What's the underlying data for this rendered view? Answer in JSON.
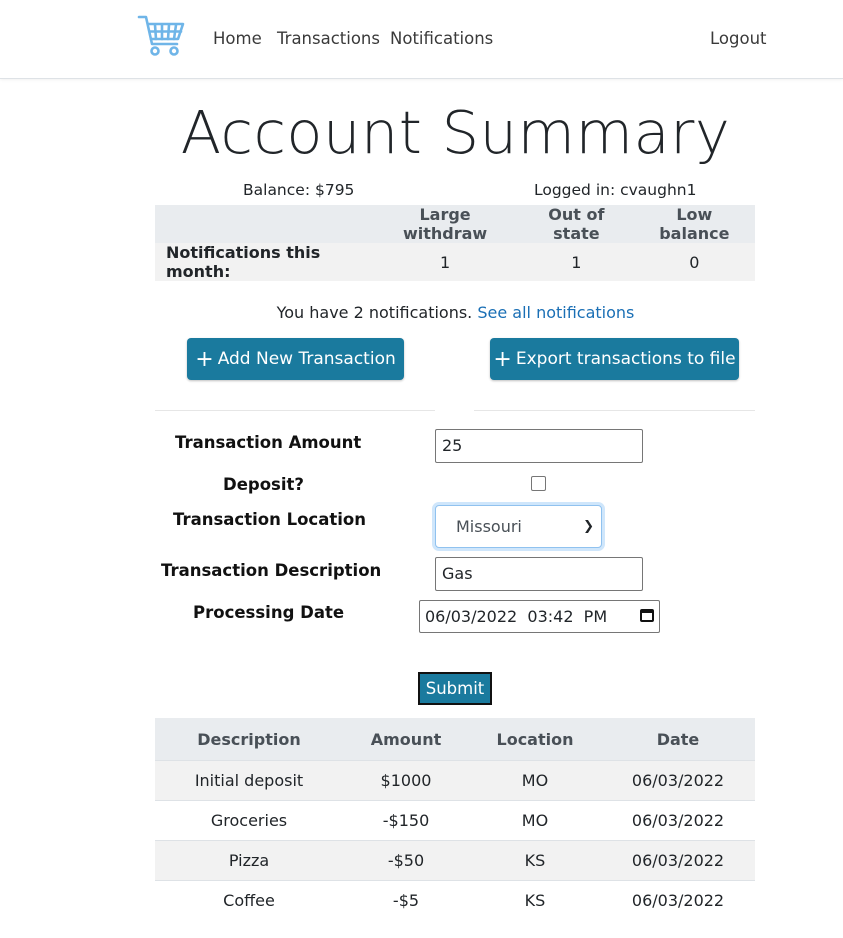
{
  "nav": {
    "links": [
      "Home",
      "Transactions",
      "Notifications"
    ],
    "logout": "Logout",
    "logo_icon": "shopping-cart-icon"
  },
  "page": {
    "title": "Account Summary",
    "balance": "Balance: $795",
    "logged_in": "Logged in: cvaughn1"
  },
  "notifications_table": {
    "headers": [
      "",
      "Large withdraw",
      "Out of state",
      "Low balance"
    ],
    "row_label": "Notifications this month:",
    "values": [
      "1",
      "1",
      "0"
    ]
  },
  "notifications_message": {
    "text": "You have 2 notifications.",
    "link": "See all notifications"
  },
  "buttons": {
    "add_transaction": "Add New Transaction",
    "export": "Export transactions to file",
    "submit": "Submit"
  },
  "form": {
    "amount_label": "Transaction Amount",
    "amount_value": "25",
    "deposit_label": "Deposit?",
    "deposit_checked": false,
    "location_label": "Transaction Location",
    "location_value": "Missouri",
    "description_label": "Transaction Description",
    "description_value": "Gas",
    "date_label": "Processing Date",
    "date_value": "06/03/2022  03:42  PM"
  },
  "transactions": {
    "headers": [
      "Description",
      "Amount",
      "Location",
      "Date"
    ],
    "rows": [
      [
        "Initial deposit",
        "$1000",
        "MO",
        "06/03/2022"
      ],
      [
        "Groceries",
        "-$150",
        "MO",
        "06/03/2022"
      ],
      [
        "Pizza",
        "-$50",
        "KS",
        "06/03/2022"
      ],
      [
        "Coffee",
        "-$5",
        "KS",
        "06/03/2022"
      ]
    ]
  },
  "colors": {
    "primary_button": "#1a7a9e",
    "link": "#1a6fb5",
    "logo": "#6fb5e8"
  }
}
